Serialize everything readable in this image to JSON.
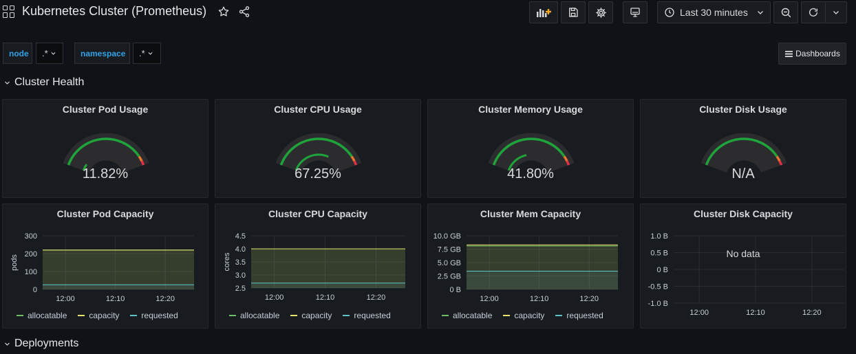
{
  "header": {
    "title": "Kubernetes Cluster (Prometheus)",
    "time_range": "Last 30 minutes"
  },
  "variables": [
    {
      "label": "node",
      "value": ".*"
    },
    {
      "label": "namespace",
      "value": ".*"
    }
  ],
  "dashboards_button": "Dashboards",
  "rows": {
    "cluster_health": "Cluster Health",
    "deployments": "Deployments"
  },
  "colors": {
    "green": "#73bf69",
    "yellow": "#e8e56f",
    "cyan": "#5fc4c7",
    "gauge_green": "#1fa43b",
    "gauge_orange": "#e8762e",
    "gauge_red": "#e02f44"
  },
  "gauges": [
    {
      "title": "Cluster Pod Usage",
      "value": "11.82%",
      "fraction": 0.1182
    },
    {
      "title": "Cluster CPU Usage",
      "value": "67.25%",
      "fraction": 0.6725
    },
    {
      "title": "Cluster Memory Usage",
      "value": "41.80%",
      "fraction": 0.418
    },
    {
      "title": "Cluster Disk Usage",
      "value": "N/A",
      "fraction": null
    }
  ],
  "legend_labels": [
    "allocatable",
    "capacity",
    "requested"
  ],
  "chart_data": [
    {
      "type": "line",
      "title": "Cluster Pod Capacity",
      "ylabel": "pods",
      "x_ticks": [
        "12:00",
        "12:10",
        "12:20"
      ],
      "y_ticks": [
        "0",
        "100",
        "200",
        "300"
      ],
      "ylim": [
        0,
        300
      ],
      "series": [
        {
          "name": "allocatable",
          "values": [
            220,
            220
          ]
        },
        {
          "name": "capacity",
          "values": [
            220,
            220
          ]
        },
        {
          "name": "requested",
          "values": [
            26,
            26
          ]
        }
      ]
    },
    {
      "type": "line",
      "title": "Cluster CPU Capacity",
      "ylabel": "cores",
      "x_ticks": [
        "12:00",
        "12:10",
        "12:20"
      ],
      "y_ticks": [
        "2.5",
        "3.0",
        "3.5",
        "4.0",
        "4.5"
      ],
      "ylim": [
        2.5,
        4.5
      ],
      "series": [
        {
          "name": "allocatable",
          "values": [
            4.0,
            4.0
          ]
        },
        {
          "name": "capacity",
          "values": [
            4.0,
            4.0
          ]
        },
        {
          "name": "requested",
          "values": [
            2.69,
            2.69
          ]
        }
      ]
    },
    {
      "type": "line",
      "title": "Cluster Mem Capacity",
      "ylabel": "",
      "x_ticks": [
        "12:00",
        "12:10",
        "12:20"
      ],
      "y_ticks": [
        "0 B",
        "2.5 GB",
        "5.0 GB",
        "7.5 GB",
        "10.0 GB"
      ],
      "ylim": [
        0,
        10
      ],
      "series": [
        {
          "name": "allocatable",
          "values": [
            8.1,
            8.1
          ]
        },
        {
          "name": "capacity",
          "values": [
            8.3,
            8.3
          ]
        },
        {
          "name": "requested",
          "values": [
            3.4,
            3.4
          ]
        }
      ]
    },
    {
      "type": "line",
      "title": "Cluster Disk Capacity",
      "ylabel": "",
      "x_ticks": [
        "12:00",
        "12:10",
        "12:20"
      ],
      "y_ticks": [
        "-1.0 B",
        "-0.5 B",
        "0 B",
        "0.5 B",
        "1.0 B"
      ],
      "ylim": [
        -1,
        1
      ],
      "no_data": "No data",
      "series": []
    }
  ]
}
